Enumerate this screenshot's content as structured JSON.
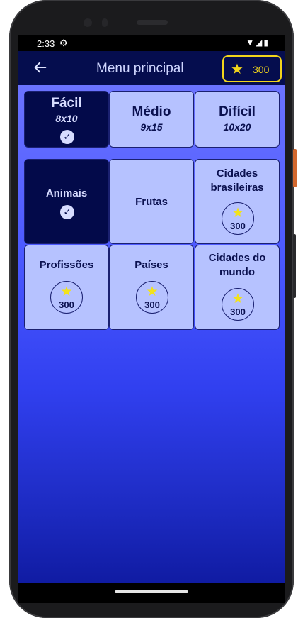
{
  "status": {
    "time": "2:33",
    "icons": [
      "settings-icon",
      "wifi-icon",
      "signal-icon",
      "battery-icon"
    ]
  },
  "appbar": {
    "back_icon": "arrow-left-icon",
    "title": "Menu principal",
    "score": "300",
    "score_icon": "star-icon"
  },
  "difficulties": [
    {
      "name": "Fácil",
      "size": "8x10",
      "selected": true
    },
    {
      "name": "Médio",
      "size": "9x15",
      "selected": false
    },
    {
      "name": "Difícil",
      "size": "10x20",
      "selected": false
    }
  ],
  "categories": [
    {
      "name": "Animais",
      "selected": true
    },
    {
      "name": "Frutas"
    },
    {
      "name": "Cidades brasileiras",
      "cost": "300"
    },
    {
      "name": "Profissões",
      "cost": "300"
    },
    {
      "name": "Países",
      "cost": "300"
    },
    {
      "name": "Cidades do mundo",
      "cost": "300"
    }
  ],
  "colors": {
    "appbar": "#050d4e",
    "tile": "#b6c2ff",
    "tile_selected": "#030a4a",
    "accent": "#f2d51b"
  }
}
